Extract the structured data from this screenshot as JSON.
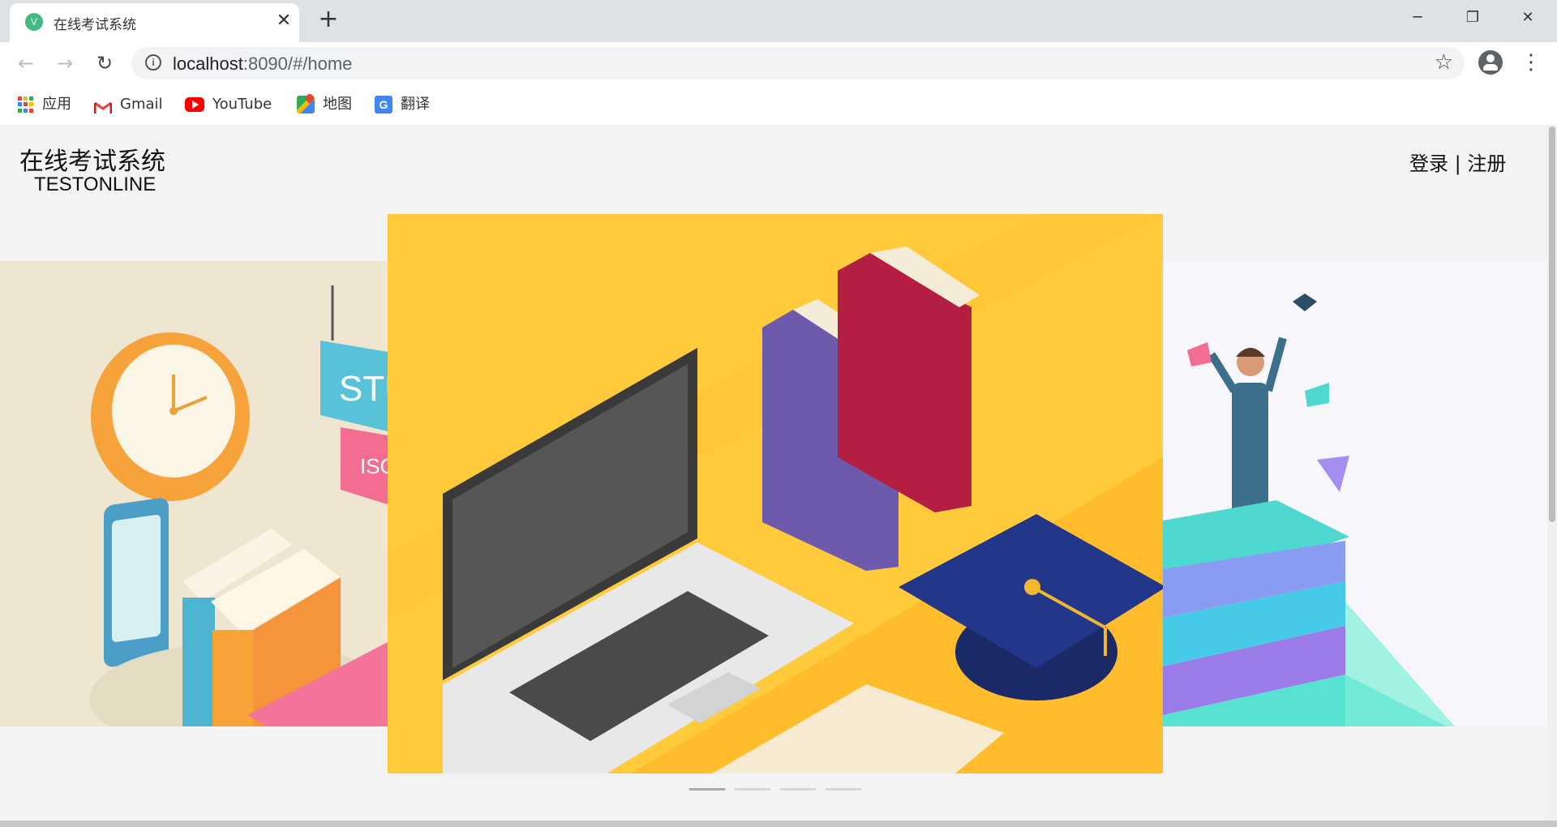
{
  "browser": {
    "tab_title": "在线考试系统",
    "tab_favicon": "vue-logo-icon",
    "url_host": "localhost",
    "url_path": ":8090/#/home",
    "bookmarks": [
      {
        "label": "应用",
        "icon": "apps-icon"
      },
      {
        "label": "Gmail",
        "icon": "gmail-icon"
      },
      {
        "label": "YouTube",
        "icon": "youtube-icon"
      },
      {
        "label": "地图",
        "icon": "maps-icon"
      },
      {
        "label": "翻译",
        "icon": "translate-icon"
      }
    ]
  },
  "header": {
    "title": "在线考试系统",
    "subtitle": "TESTONLINE",
    "login": "登录",
    "separator": "|",
    "register": "注册"
  },
  "carousel": {
    "slide_count": 4,
    "active_index": 0,
    "left_sign_text": "STU",
    "left_sign_sub": "ISO",
    "colors": {
      "left_bg": "#efe6d1",
      "center_bg": "#ffcb3d",
      "right_bg": "#f7f7fb"
    }
  }
}
